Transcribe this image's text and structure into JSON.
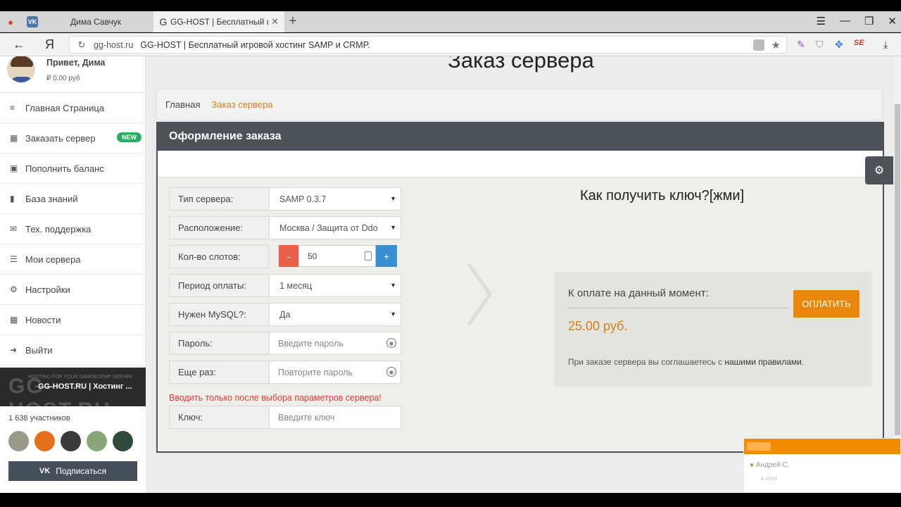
{
  "browser": {
    "tabs": [
      {
        "label": "Дима Савчук",
        "favicon": "vk-icon"
      },
      {
        "label": "GG-HOST | Бесплатный и",
        "favicon": "G"
      }
    ],
    "new_tab": "+",
    "favicon_vk": "VK",
    "favicon_gg": "G",
    "back": "←",
    "yandex": "Я",
    "reload": "↻",
    "url_domain": "gg-host.ru",
    "url_title": "GG-HOST | Бесплатный игровой хостинг SAMP и CRMP."
  },
  "sidebar": {
    "greeting": "Привет, Дима",
    "balance": "₽ 0.00 руб",
    "items": [
      {
        "label": "Главная Страница",
        "icon": "≡"
      },
      {
        "label": "Заказать сервер",
        "icon": "▦",
        "badge": "NEW"
      },
      {
        "label": "Пополнить баланс",
        "icon": "▣"
      },
      {
        "label": "База знаний",
        "icon": "▮"
      },
      {
        "label": "Тех. поддержка",
        "icon": "✉"
      },
      {
        "label": "Мои сервера",
        "icon": "☰"
      },
      {
        "label": "Настройки",
        "icon": "⚙"
      },
      {
        "label": "Новости",
        "icon": "▦"
      },
      {
        "label": "Выйти",
        "icon": "➜"
      }
    ],
    "vk_widget": {
      "cover_logo": "GG-HOST.RU",
      "cover_small": "HOSTING FOR YOUR SAMP&CRMP SERVER",
      "title": "GG-HOST.RU | Хостинг ...",
      "members": "1 638 участников",
      "subscribe": "Подписаться",
      "vk_logo": "VK"
    }
  },
  "main": {
    "title": "Заказ сервера",
    "breadcrumb": {
      "home": "Главная",
      "current": "Заказ сервера"
    },
    "panel_title": "Оформление заказа",
    "form": {
      "server_type": {
        "label": "Тип сервера:",
        "value": "SAMP 0.3.7"
      },
      "location": {
        "label": "Расположение:",
        "value": "Москва / Защита от Ddo"
      },
      "slots": {
        "label": "Кол-во слотов:",
        "value": "50",
        "minus": "-",
        "plus": "+"
      },
      "period": {
        "label": "Период оплаты:",
        "value": "1 месяц"
      },
      "mysql": {
        "label": "Нужен MySQL?:",
        "value": "Да"
      },
      "password": {
        "label": "Пароль:",
        "placeholder": "Введите пароль"
      },
      "password_repeat": {
        "label": "Еще раз:",
        "placeholder": "Повторите пароль"
      },
      "warning": "Вводить только после выбора параметров сервера!",
      "key": {
        "label": "Ключ:",
        "placeholder": "Введите ключ"
      }
    },
    "howto_link": "Как получить ключ?[жми]",
    "payment": {
      "label": "К оплате на данный момент:",
      "amount": "25.00 руб.",
      "button": "ОПЛАТИТЬ",
      "note": "При заказе сервера вы соглашаетесь с",
      "rules_link": "нашими правилами",
      "note_end": "."
    }
  },
  "notification": {
    "name": "Андрей С.",
    "detail": "в сети"
  },
  "colors": {
    "accent_orange": "#e8870c",
    "panel_dark": "#4c5257",
    "new_badge": "#27ae60",
    "minus_red": "#e8604c",
    "plus_blue": "#3a8fd0",
    "warning_red": "#e53935"
  }
}
